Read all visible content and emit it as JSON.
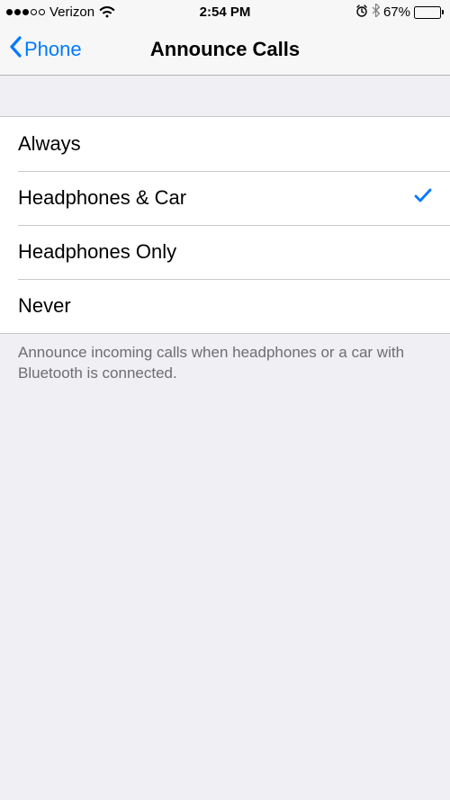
{
  "status_bar": {
    "carrier": "Verizon",
    "time": "2:54 PM",
    "battery_percent": "67%",
    "battery_level": 67
  },
  "nav": {
    "back_label": "Phone",
    "title": "Announce Calls"
  },
  "options": [
    {
      "label": "Always",
      "selected": false
    },
    {
      "label": "Headphones & Car",
      "selected": true
    },
    {
      "label": "Headphones Only",
      "selected": false
    },
    {
      "label": "Never",
      "selected": false
    }
  ],
  "footer": "Announce incoming calls when headphones or a car with Bluetooth is connected."
}
